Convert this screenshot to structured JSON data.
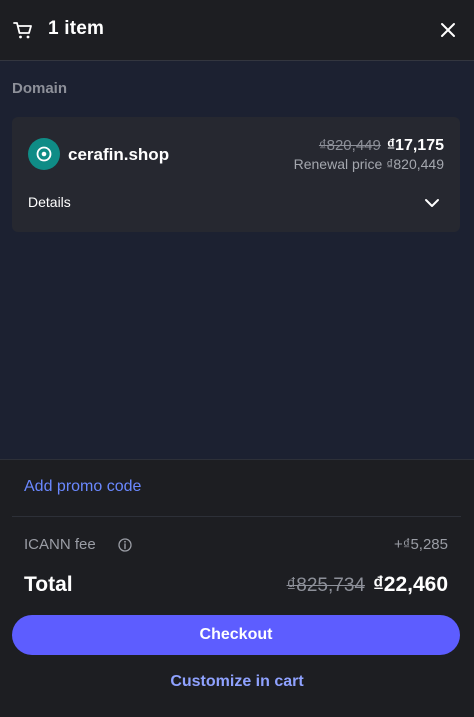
{
  "header": {
    "title": "1 item",
    "icon": "cart-icon",
    "close_icon": "close-icon"
  },
  "domain_section": {
    "label": "Domain",
    "item": {
      "name": "cerafin.shop",
      "old_price": "₫820,449",
      "new_price": "₫17,175",
      "renewal": "Renewal price ₫820,449",
      "details_label": "Details",
      "icon": "domain-target-icon",
      "icon_color": "#0f8c86"
    }
  },
  "footer": {
    "promo_label": "Add promo code",
    "fee_label": "ICANN fee",
    "fee_value": "+₫5,285",
    "total_label": "Total",
    "total_old": "₫825,734",
    "total_new": "₫22,460",
    "checkout_label": "Checkout",
    "customize_label": "Customize in cart"
  },
  "colors": {
    "accent": "#5d5dff",
    "link": "#6a88ff",
    "background": "#1c2131"
  }
}
